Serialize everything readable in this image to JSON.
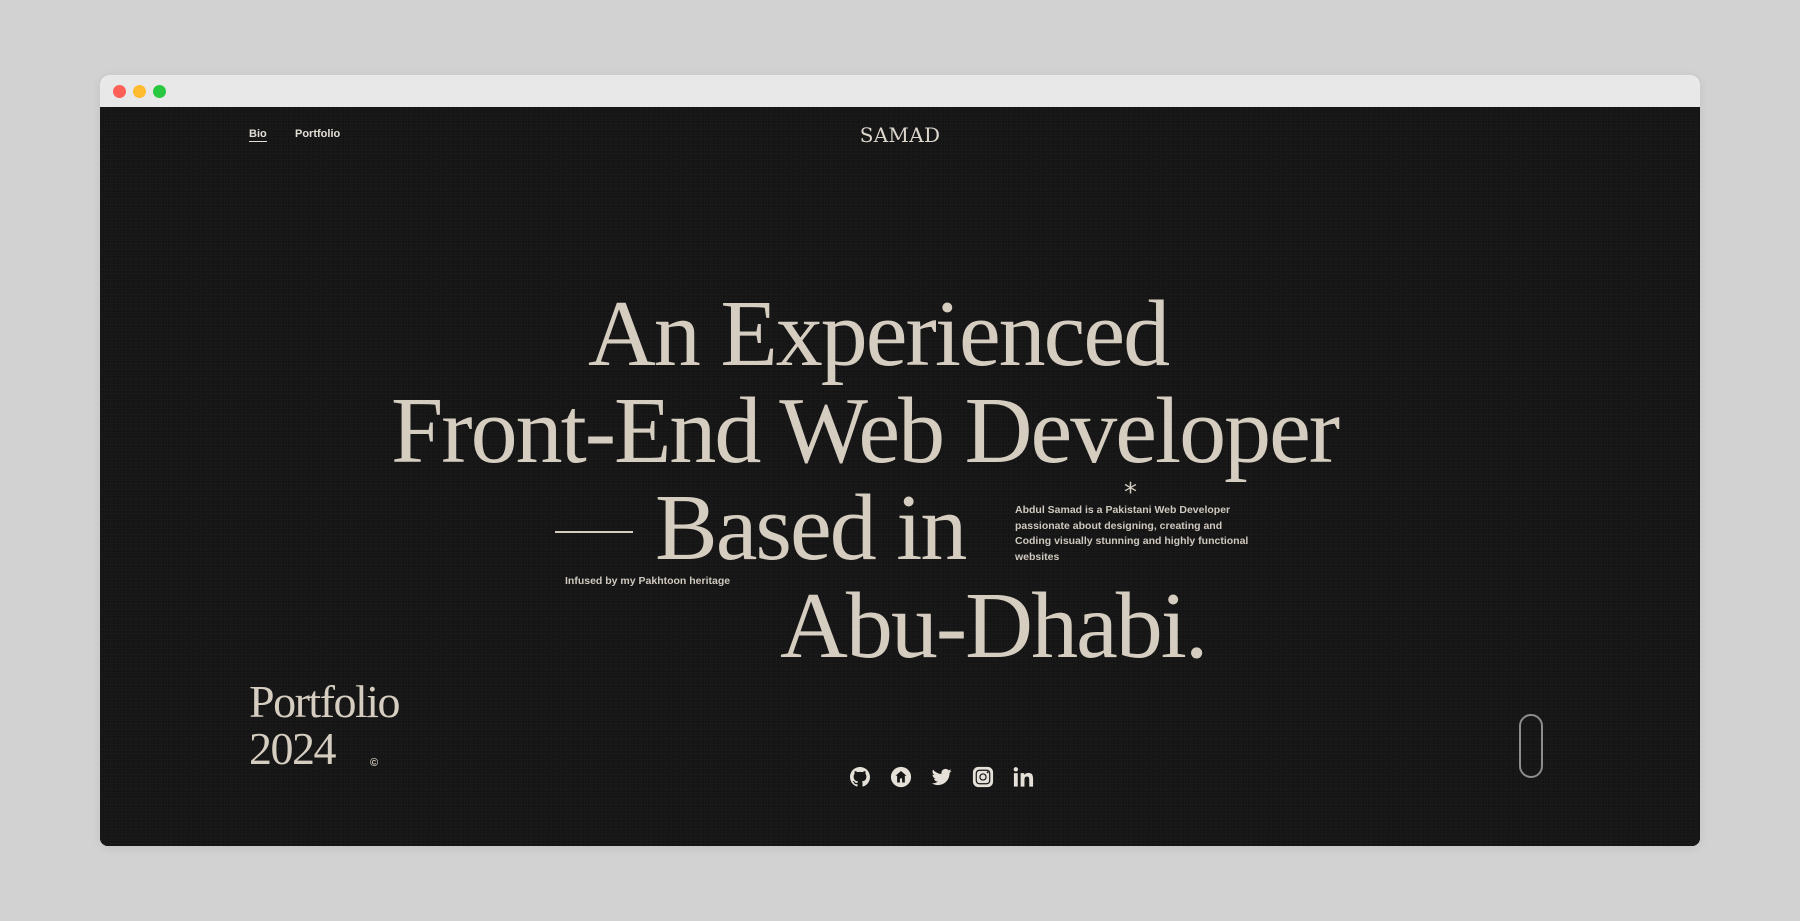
{
  "nav": {
    "links": [
      {
        "label": "Bio"
      },
      {
        "label": "Portfolio"
      }
    ],
    "brand": "SAMAD"
  },
  "hero": {
    "line1": "An Experienced",
    "line2": "Front-End Web Developer",
    "line3": "Based in",
    "line4": "Abu-Dhabi.",
    "tagline": "Infused by my Pakhtoon heritage",
    "asterisk": "*",
    "bio": "Abdul Samad is a Pakistani Web Developer passionate about designing, creating and Coding visually stunning and highly functional websites"
  },
  "footer": {
    "portfolio_label": "Portfolio",
    "year": "2024",
    "copyright": "©",
    "socials": [
      {
        "icon": "github-icon"
      },
      {
        "icon": "home-icon"
      },
      {
        "icon": "twitter-icon"
      },
      {
        "icon": "instagram-icon"
      },
      {
        "icon": "linkedin-icon"
      }
    ]
  },
  "colors": {
    "background": "#161616",
    "text": "#d6cdc1",
    "frame": "#d2d2d2"
  }
}
